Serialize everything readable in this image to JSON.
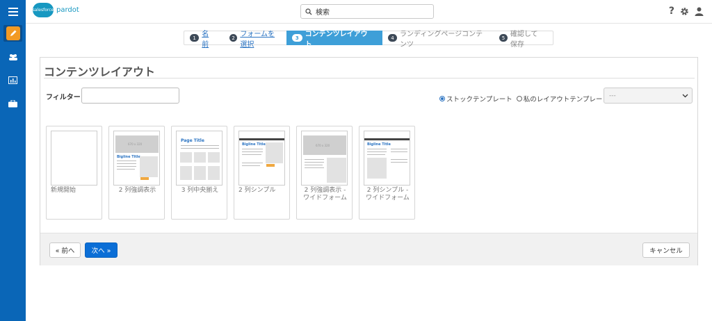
{
  "header": {
    "logo_text": "salesforce",
    "product": "pardot",
    "search": {
      "value": "検索"
    }
  },
  "wizard": {
    "steps": [
      {
        "num": "1",
        "label": "名前"
      },
      {
        "num": "2",
        "label": "フォームを選択"
      },
      {
        "num": "3",
        "label": "コンテンツレイアウト"
      },
      {
        "num": "4",
        "label": "ランディングページコンテンツ"
      },
      {
        "num": "5",
        "label": "確認して保存"
      }
    ]
  },
  "main": {
    "title": "コンテンツレイアウト",
    "filter_label": "フィルター",
    "filter_value": "",
    "radio_stock": "ストックテンプレート",
    "radio_mine": "私のレイアウトテンプレート",
    "select_value": "---",
    "thumb_placeholder": "670 x 320",
    "thumb_page_title": "Page Title",
    "thumb_bigline_title": "Bigline Title",
    "templates": [
      {
        "label": "新規開始"
      },
      {
        "label": "2 列強調表示"
      },
      {
        "label": "3 列中央揃え"
      },
      {
        "label": "2 列シンプル"
      },
      {
        "label": "2 列強調表示 -\nワイドフォーム"
      },
      {
        "label": "2 列シンプル -\nワイドフォーム"
      }
    ]
  },
  "footer": {
    "prev": "« 前へ",
    "next": "次へ »",
    "cancel": "キャンセル"
  },
  "colors": {
    "nav_blue": "#0a66b7",
    "active_step": "#3e9fd8",
    "primary_button": "#0b6ed6",
    "active_nav_icon": "#f29a24"
  }
}
